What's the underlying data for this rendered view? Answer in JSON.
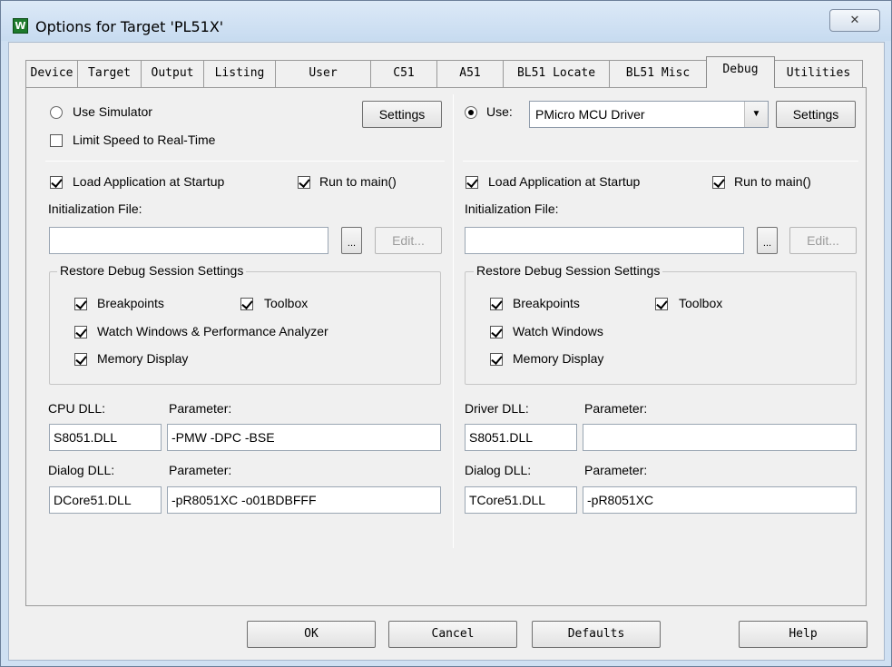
{
  "window": {
    "title": "Options for Target 'PL51X'",
    "app_icon_glyph": "W",
    "close_glyph": "✕"
  },
  "tabs": [
    {
      "label": "Device",
      "active": false
    },
    {
      "label": "Target",
      "active": false
    },
    {
      "label": "Output",
      "active": false
    },
    {
      "label": "Listing",
      "active": false
    },
    {
      "label": "User",
      "active": false
    },
    {
      "label": "C51",
      "active": false
    },
    {
      "label": "A51",
      "active": false
    },
    {
      "label": "BL51 Locate",
      "active": false
    },
    {
      "label": "BL51 Misc",
      "active": false
    },
    {
      "label": "Debug",
      "active": true
    },
    {
      "label": "Utilities",
      "active": false
    }
  ],
  "left": {
    "use_simulator": "Use Simulator",
    "use_simulator_selected": false,
    "settings": "Settings",
    "limit_speed": "Limit Speed to Real-Time",
    "limit_speed_checked": false,
    "load_app": "Load Application at Startup",
    "load_app_checked": true,
    "run_to_main": "Run to main()",
    "run_to_main_checked": true,
    "init_file_label": "Initialization File:",
    "init_file_value": "",
    "browse": "...",
    "edit": "Edit...",
    "restore_title": "Restore Debug Session Settings",
    "breakpoints": "Breakpoints",
    "toolbox": "Toolbox",
    "watch": "Watch Windows & Performance Analyzer",
    "memory": "Memory Display",
    "cpu_dll_label": "CPU DLL:",
    "cpu_param_label": "Parameter:",
    "cpu_dll_value": "S8051.DLL",
    "cpu_param_value": "-PMW -DPC -BSE",
    "dialog_dll_label": "Dialog DLL:",
    "dialog_param_label": "Parameter:",
    "dialog_dll_value": "DCore51.DLL",
    "dialog_param_value": "-pR8051XC -o01BDBFFF"
  },
  "right": {
    "use": "Use:",
    "use_selected": true,
    "driver_select": "PMicro MCU Driver",
    "settings": "Settings",
    "load_app": "Load Application at Startup",
    "load_app_checked": true,
    "run_to_main": "Run to main()",
    "run_to_main_checked": true,
    "init_file_label": "Initialization File:",
    "init_file_value": "",
    "browse": "...",
    "edit": "Edit...",
    "restore_title": "Restore Debug Session Settings",
    "breakpoints": "Breakpoints",
    "toolbox": "Toolbox",
    "watch": "Watch Windows",
    "memory": "Memory Display",
    "driver_dll_label": "Driver DLL:",
    "driver_param_label": "Parameter:",
    "driver_dll_value": "S8051.DLL",
    "driver_param_value": "",
    "dialog_dll_label": "Dialog DLL:",
    "dialog_param_label": "Parameter:",
    "dialog_dll_value": "TCore51.DLL",
    "dialog_param_value": "-pR8051XC"
  },
  "footer": {
    "ok": "OK",
    "cancel": "Cancel",
    "defaults": "Defaults",
    "help": "Help"
  }
}
